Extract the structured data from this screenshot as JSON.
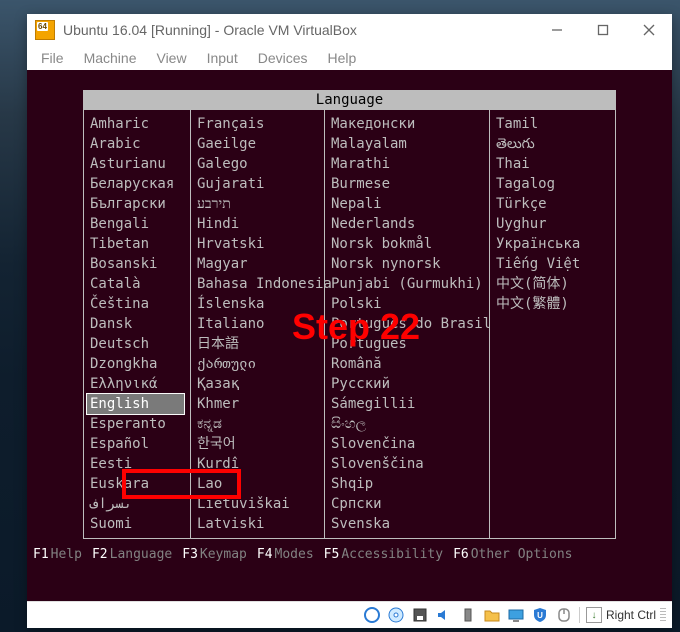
{
  "window": {
    "title": "Ubuntu 16.04 [Running] - Oracle VM VirtualBox",
    "menu": [
      "File",
      "Machine",
      "View",
      "Input",
      "Devices",
      "Help"
    ],
    "hostkey": "Right Ctrl"
  },
  "installer": {
    "header": "Language",
    "columns": [
      [
        "Amharic",
        "Arabic",
        "Asturianu",
        "Беларуская",
        "Български",
        "Bengali",
        "Tibetan",
        "Bosanski",
        "Català",
        "Čeština",
        "Dansk",
        "Deutsch",
        "Dzongkha",
        "Ελληνικά",
        "English",
        "Esperanto",
        "Español",
        "Eesti",
        "Euskara",
        "ىسراف",
        "Suomi"
      ],
      [
        "Français",
        "Gaeilge",
        "Galego",
        "Gujarati",
        "תירבע",
        "Hindi",
        "Hrvatski",
        "Magyar",
        "Bahasa Indonesia",
        "Íslenska",
        "Italiano",
        "日本語",
        "ქართული",
        "Қазақ",
        "Khmer",
        "ಕನ್ನಡ",
        "한국어",
        "Kurdî",
        "Lao",
        "Lietuviškai",
        "Latviski"
      ],
      [
        "Македонски",
        "Malayalam",
        "Marathi",
        "Burmese",
        "Nepali",
        "Nederlands",
        "Norsk bokmål",
        "Norsk nynorsk",
        "Punjabi (Gurmukhi)",
        "Polski",
        "Português do Brasil",
        "Português",
        "Română",
        "Русский",
        "Sámegillii",
        "සිංහල",
        "Slovenčina",
        "Slovenščina",
        "Shqip",
        "Српски",
        "Svenska"
      ],
      [
        "Tamil",
        "తెలుగు",
        "Thai",
        "Tagalog",
        "Türkçe",
        "Uyghur",
        "Українська",
        "Tiếng Việt",
        "中文(简体)",
        "中文(繁體)"
      ]
    ],
    "selected": "English",
    "func": [
      {
        "k": "F1",
        "l": "Help"
      },
      {
        "k": "F2",
        "l": "Language"
      },
      {
        "k": "F3",
        "l": "Keymap"
      },
      {
        "k": "F4",
        "l": "Modes"
      },
      {
        "k": "F5",
        "l": "Accessibility"
      },
      {
        "k": "F6",
        "l": "Other Options"
      }
    ]
  },
  "status_icons": [
    "disc-icon",
    "cd-icon",
    "floppy-icon",
    "sound-icon",
    "usb-icon",
    "folder-icon",
    "display-icon",
    "shield-icon",
    "mouse-capture-icon"
  ],
  "annotation": {
    "label": "Step 22"
  },
  "colors": {
    "screen_bg": "#2b0015",
    "red": "#ff0000",
    "text": "#bdbdbd"
  }
}
